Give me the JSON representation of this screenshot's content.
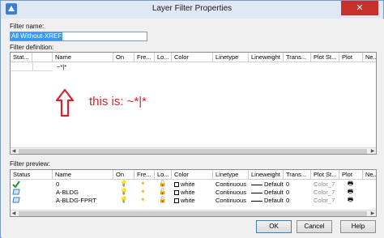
{
  "window": {
    "title": "Layer Filter Properties",
    "close_glyph": "✕"
  },
  "filter_name": {
    "label": "Filter name:",
    "value": "All Without-XREF"
  },
  "filter_definition": {
    "label": "Filter definition:",
    "columns": [
      "Stat...",
      "Name",
      "On",
      "Fre...",
      "Lo...",
      "Color",
      "Linetype",
      "Lineweight",
      "Trans...",
      "Plot St...",
      "Plot",
      "Ne..."
    ],
    "row": {
      "name": "~*|*"
    }
  },
  "annotation": {
    "text": "this is: ~*|*",
    "color": "#d9232c"
  },
  "filter_preview": {
    "label": "Filter preview:",
    "columns": [
      "Status",
      "Name",
      "On",
      "Fre...",
      "Lo...",
      "Color",
      "Linetype",
      "Lineweight",
      "Trans...",
      "Plot St...",
      "Plot",
      "Ne..."
    ],
    "rows": [
      {
        "status_icon": "checkmark-icon",
        "name": "0",
        "color": "white",
        "linetype": "Continuous",
        "lineweight": "Default",
        "transparency": "0",
        "plot_style": "Color_7"
      },
      {
        "status_icon": "layer-icon",
        "name": "A-BLDG",
        "color": "white",
        "linetype": "Continuous",
        "lineweight": "Default",
        "transparency": "0",
        "plot_style": "Color_7"
      },
      {
        "status_icon": "layer-icon",
        "name": "A-BLDG-FPRT",
        "color": "white",
        "linetype": "Continuous",
        "lineweight": "Default",
        "transparency": "0",
        "plot_style": "Color_7"
      }
    ]
  },
  "buttons": {
    "ok": "OK",
    "cancel": "Cancel",
    "help": "Help"
  }
}
